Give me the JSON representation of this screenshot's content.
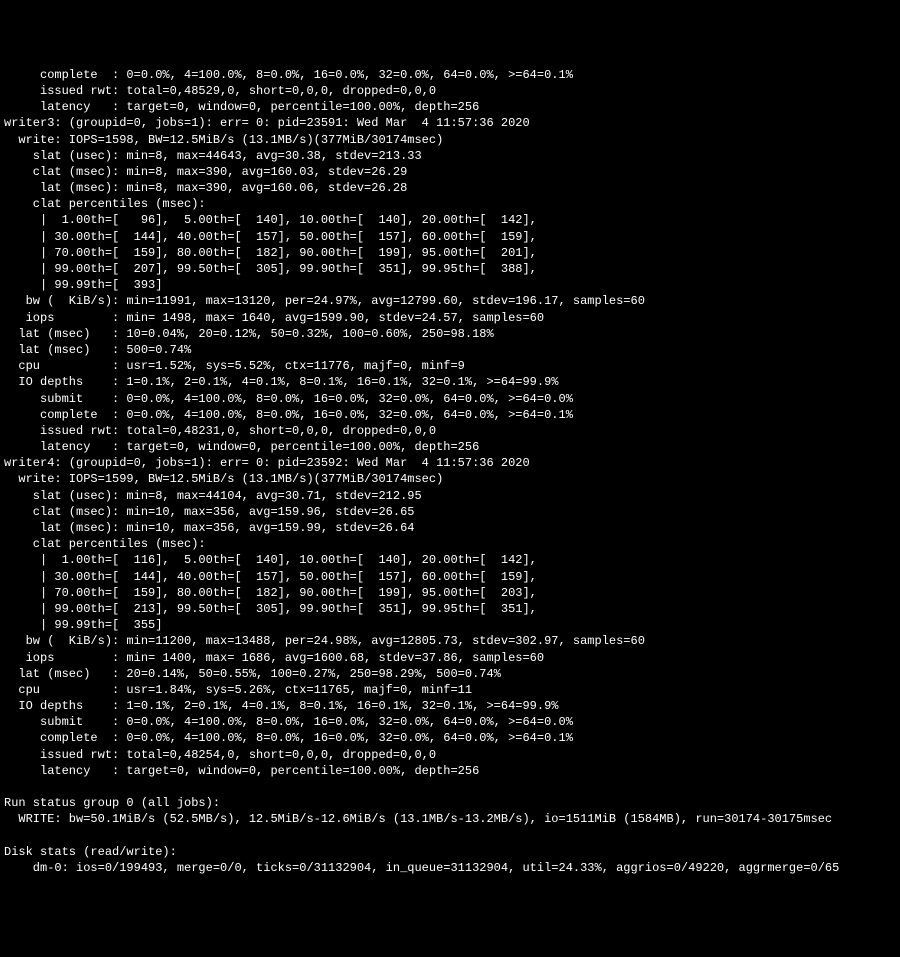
{
  "lines": [
    "     complete  : 0=0.0%, 4=100.0%, 8=0.0%, 16=0.0%, 32=0.0%, 64=0.0%, >=64=0.1%",
    "     issued rwt: total=0,48529,0, short=0,0,0, dropped=0,0,0",
    "     latency   : target=0, window=0, percentile=100.00%, depth=256",
    "writer3: (groupid=0, jobs=1): err= 0: pid=23591: Wed Mar  4 11:57:36 2020",
    "  write: IOPS=1598, BW=12.5MiB/s (13.1MB/s)(377MiB/30174msec)",
    "    slat (usec): min=8, max=44643, avg=30.38, stdev=213.33",
    "    clat (msec): min=8, max=390, avg=160.03, stdev=26.29",
    "     lat (msec): min=8, max=390, avg=160.06, stdev=26.28",
    "    clat percentiles (msec):",
    "     |  1.00th=[   96],  5.00th=[  140], 10.00th=[  140], 20.00th=[  142],",
    "     | 30.00th=[  144], 40.00th=[  157], 50.00th=[  157], 60.00th=[  159],",
    "     | 70.00th=[  159], 80.00th=[  182], 90.00th=[  199], 95.00th=[  201],",
    "     | 99.00th=[  207], 99.50th=[  305], 99.90th=[  351], 99.95th=[  388],",
    "     | 99.99th=[  393]",
    "   bw (  KiB/s): min=11991, max=13120, per=24.97%, avg=12799.60, stdev=196.17, samples=60",
    "   iops        : min= 1498, max= 1640, avg=1599.90, stdev=24.57, samples=60",
    "  lat (msec)   : 10=0.04%, 20=0.12%, 50=0.32%, 100=0.60%, 250=98.18%",
    "  lat (msec)   : 500=0.74%",
    "  cpu          : usr=1.52%, sys=5.52%, ctx=11776, majf=0, minf=9",
    "  IO depths    : 1=0.1%, 2=0.1%, 4=0.1%, 8=0.1%, 16=0.1%, 32=0.1%, >=64=99.9%",
    "     submit    : 0=0.0%, 4=100.0%, 8=0.0%, 16=0.0%, 32=0.0%, 64=0.0%, >=64=0.0%",
    "     complete  : 0=0.0%, 4=100.0%, 8=0.0%, 16=0.0%, 32=0.0%, 64=0.0%, >=64=0.1%",
    "     issued rwt: total=0,48231,0, short=0,0,0, dropped=0,0,0",
    "     latency   : target=0, window=0, percentile=100.00%, depth=256",
    "writer4: (groupid=0, jobs=1): err= 0: pid=23592: Wed Mar  4 11:57:36 2020",
    "  write: IOPS=1599, BW=12.5MiB/s (13.1MB/s)(377MiB/30174msec)",
    "    slat (usec): min=8, max=44104, avg=30.71, stdev=212.95",
    "    clat (msec): min=10, max=356, avg=159.96, stdev=26.65",
    "     lat (msec): min=10, max=356, avg=159.99, stdev=26.64",
    "    clat percentiles (msec):",
    "     |  1.00th=[  116],  5.00th=[  140], 10.00th=[  140], 20.00th=[  142],",
    "     | 30.00th=[  144], 40.00th=[  157], 50.00th=[  157], 60.00th=[  159],",
    "     | 70.00th=[  159], 80.00th=[  182], 90.00th=[  199], 95.00th=[  203],",
    "     | 99.00th=[  213], 99.50th=[  305], 99.90th=[  351], 99.95th=[  351],",
    "     | 99.99th=[  355]",
    "   bw (  KiB/s): min=11200, max=13488, per=24.98%, avg=12805.73, stdev=302.97, samples=60",
    "   iops        : min= 1400, max= 1686, avg=1600.68, stdev=37.86, samples=60",
    "  lat (msec)   : 20=0.14%, 50=0.55%, 100=0.27%, 250=98.29%, 500=0.74%",
    "  cpu          : usr=1.84%, sys=5.26%, ctx=11765, majf=0, minf=11",
    "  IO depths    : 1=0.1%, 2=0.1%, 4=0.1%, 8=0.1%, 16=0.1%, 32=0.1%, >=64=99.9%",
    "     submit    : 0=0.0%, 4=100.0%, 8=0.0%, 16=0.0%, 32=0.0%, 64=0.0%, >=64=0.0%",
    "     complete  : 0=0.0%, 4=100.0%, 8=0.0%, 16=0.0%, 32=0.0%, 64=0.0%, >=64=0.1%",
    "     issued rwt: total=0,48254,0, short=0,0,0, dropped=0,0,0",
    "     latency   : target=0, window=0, percentile=100.00%, depth=256",
    "",
    "Run status group 0 (all jobs):",
    "  WRITE: bw=50.1MiB/s (52.5MB/s), 12.5MiB/s-12.6MiB/s (13.1MB/s-13.2MB/s), io=1511MiB (1584MB), run=30174-30175msec",
    "",
    "Disk stats (read/write):",
    "    dm-0: ios=0/199493, merge=0/0, ticks=0/31132904, in_queue=31132904, util=24.33%, aggrios=0/49220, aggrmerge=0/65"
  ]
}
